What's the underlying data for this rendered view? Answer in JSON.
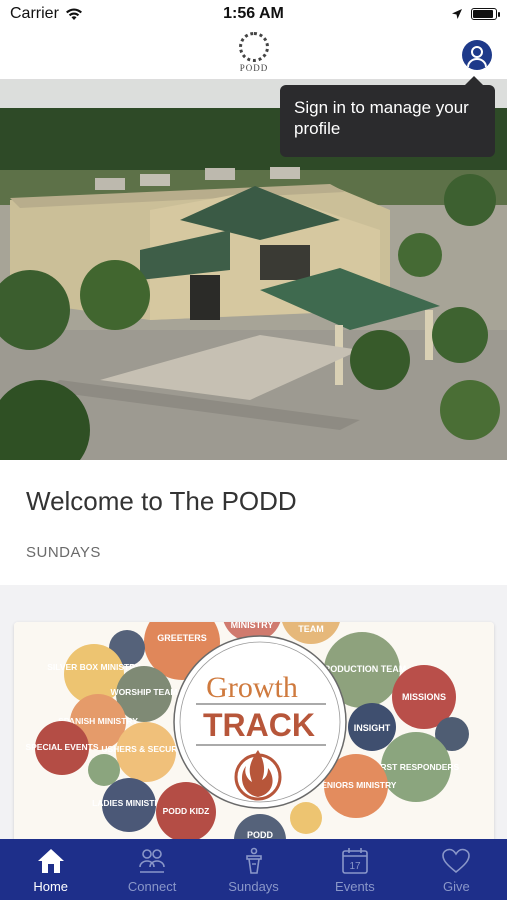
{
  "status": {
    "carrier": "Carrier",
    "time": "1:56 AM",
    "battery_fraction": 0.95
  },
  "header": {
    "logo_text": "PODD",
    "profile_icon": "user-icon"
  },
  "tooltip": {
    "text": "Sign in to manage your profile"
  },
  "welcome": {
    "title": "Welcome to The PODD",
    "subtitle": "SUNDAYS"
  },
  "growth_graphic": {
    "center_title": "Growth",
    "center_subtitle": "TRACK",
    "bubbles": [
      "GREETERS",
      "MINISTRY",
      "TEAM",
      "SILVER BOX MINISTRY",
      "WORSHIP TEAM",
      "PRODUCTION TEAM",
      "MISSIONS",
      "SPANISH MINISTRY",
      "INSIGHT",
      "SPECIAL EVENTS",
      "USHERS & SECURITY",
      "FIRST RESPONDERS",
      "SENIORS MINISTRY",
      "LADIES MINISTRY",
      "PODD KIDZ",
      "PODD"
    ]
  },
  "tabs": [
    {
      "label": "Home",
      "icon": "home-icon",
      "active": true
    },
    {
      "label": "Connect",
      "icon": "people-icon",
      "active": false
    },
    {
      "label": "Sundays",
      "icon": "podium-icon",
      "active": false
    },
    {
      "label": "Events",
      "icon": "calendar-icon",
      "active": false,
      "badge": "17"
    },
    {
      "label": "Give",
      "icon": "heart-icon",
      "active": false
    }
  ],
  "colors": {
    "brand": "#1e2f8a",
    "profile": "#1e3a8a"
  }
}
